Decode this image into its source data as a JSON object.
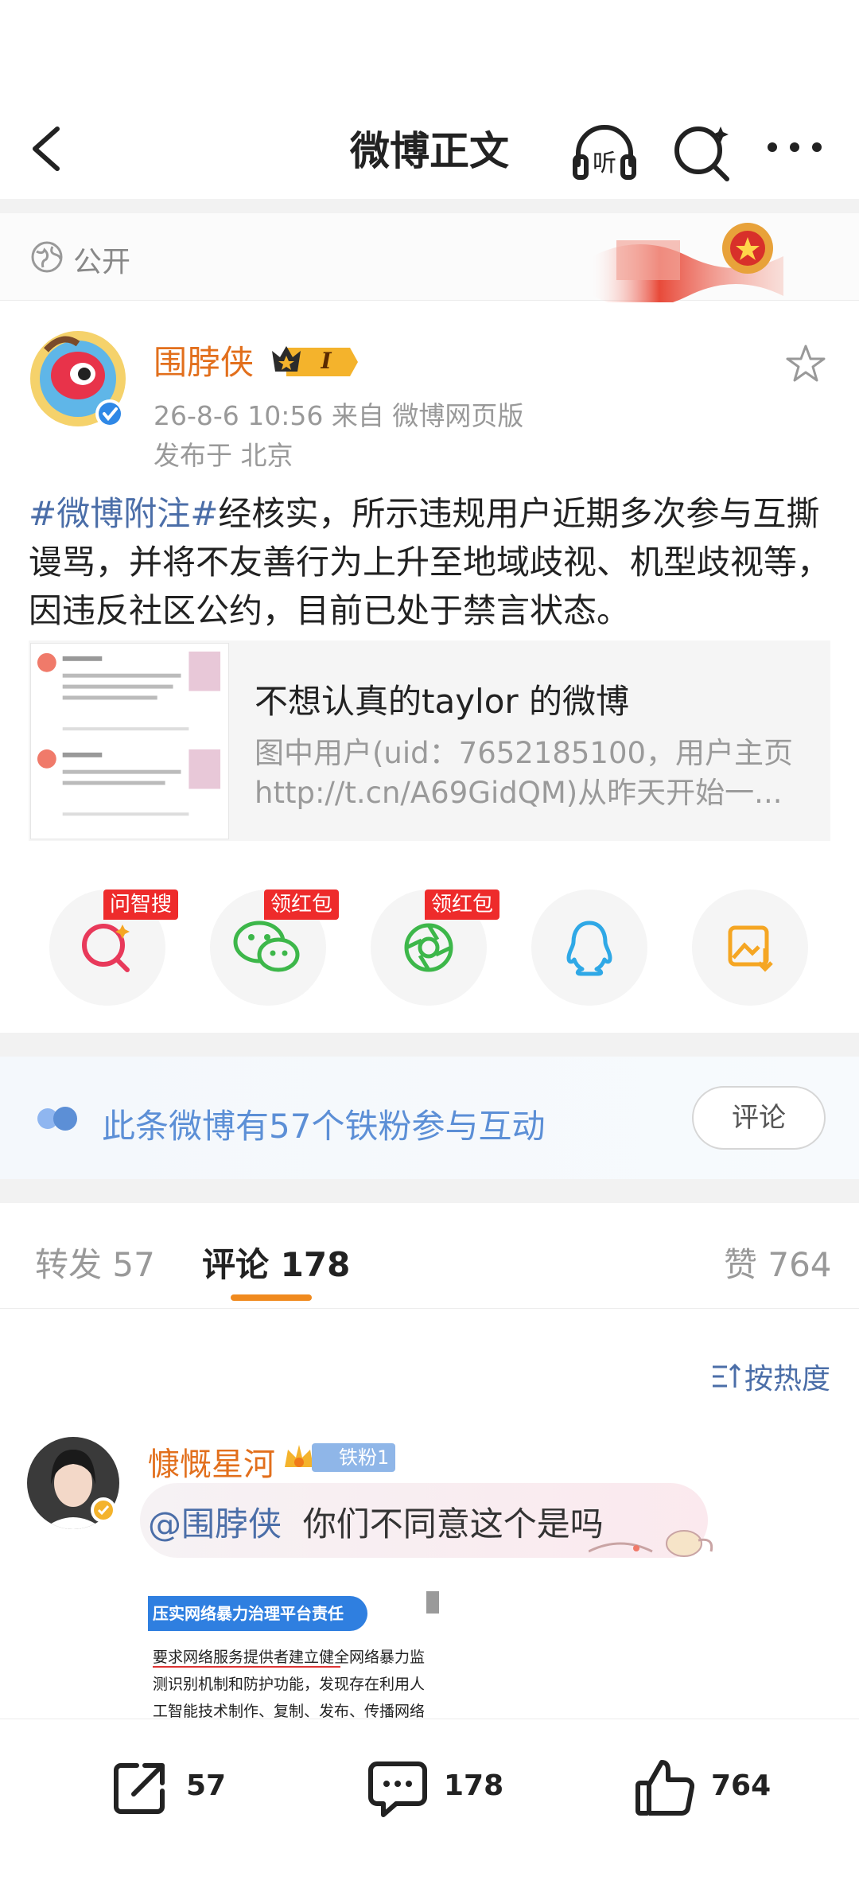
{
  "header": {
    "title": "微博正文"
  },
  "visibility": {
    "label": "公开"
  },
  "author": {
    "name": "围脖侠",
    "time_source": "26-8-6 10:56  来自 微博网页版",
    "location": "发布于 北京"
  },
  "post": {
    "hashtag": "#微博附注#",
    "text": "经核实，所示违规用户近期多次参与互撕谩骂，并将不友善行为上升至地域歧视、机型歧视等，因违反社区公约，目前已处于禁言状态。"
  },
  "card": {
    "title": "不想认真的taylor 的微博",
    "desc_line1": "图中用户(uid：7652185100，用户主页",
    "desc_line2": "http://t.cn/A69GidQM)从昨天开始一..."
  },
  "share": {
    "badges": [
      "问智搜",
      "领红包",
      "领红包"
    ],
    "icons": [
      "ai-search-icon",
      "wechat-icon",
      "moments-icon",
      "qq-icon",
      "save-image-icon"
    ],
    "colors": {
      "badge": "#ee2b2b",
      "search": "#e8395a",
      "wechat": "#3db74a",
      "qq": "#2fa8e6",
      "save": "#f5a623"
    }
  },
  "fans": {
    "text": "此条微博有57个铁粉参与互动",
    "button": "评论"
  },
  "tabs": {
    "repost": "转发 57",
    "comments": "评论 178",
    "likes": "赞 764"
  },
  "sort": {
    "label": "按热度"
  },
  "comment": {
    "user": "慷慨星河",
    "fan_badge": "铁粉1",
    "mention": "@围脖侠",
    "text": "你们不同意这个是吗",
    "image_lines": [
      "压实网络暴力治理平台责任",
      "要求网络服务提供者建立健全网络暴力监",
      "测识别机制和防护功能，发现存在利用人",
      "工智能技术制作、复制、发布、传播网络"
    ]
  },
  "bottom_bar": {
    "reposts": "57",
    "comments": "178",
    "likes": "764"
  },
  "accent_colors": {
    "orange": "#e26f1c",
    "link": "#4b6ea8",
    "tab_underline": "#f08a1e"
  }
}
